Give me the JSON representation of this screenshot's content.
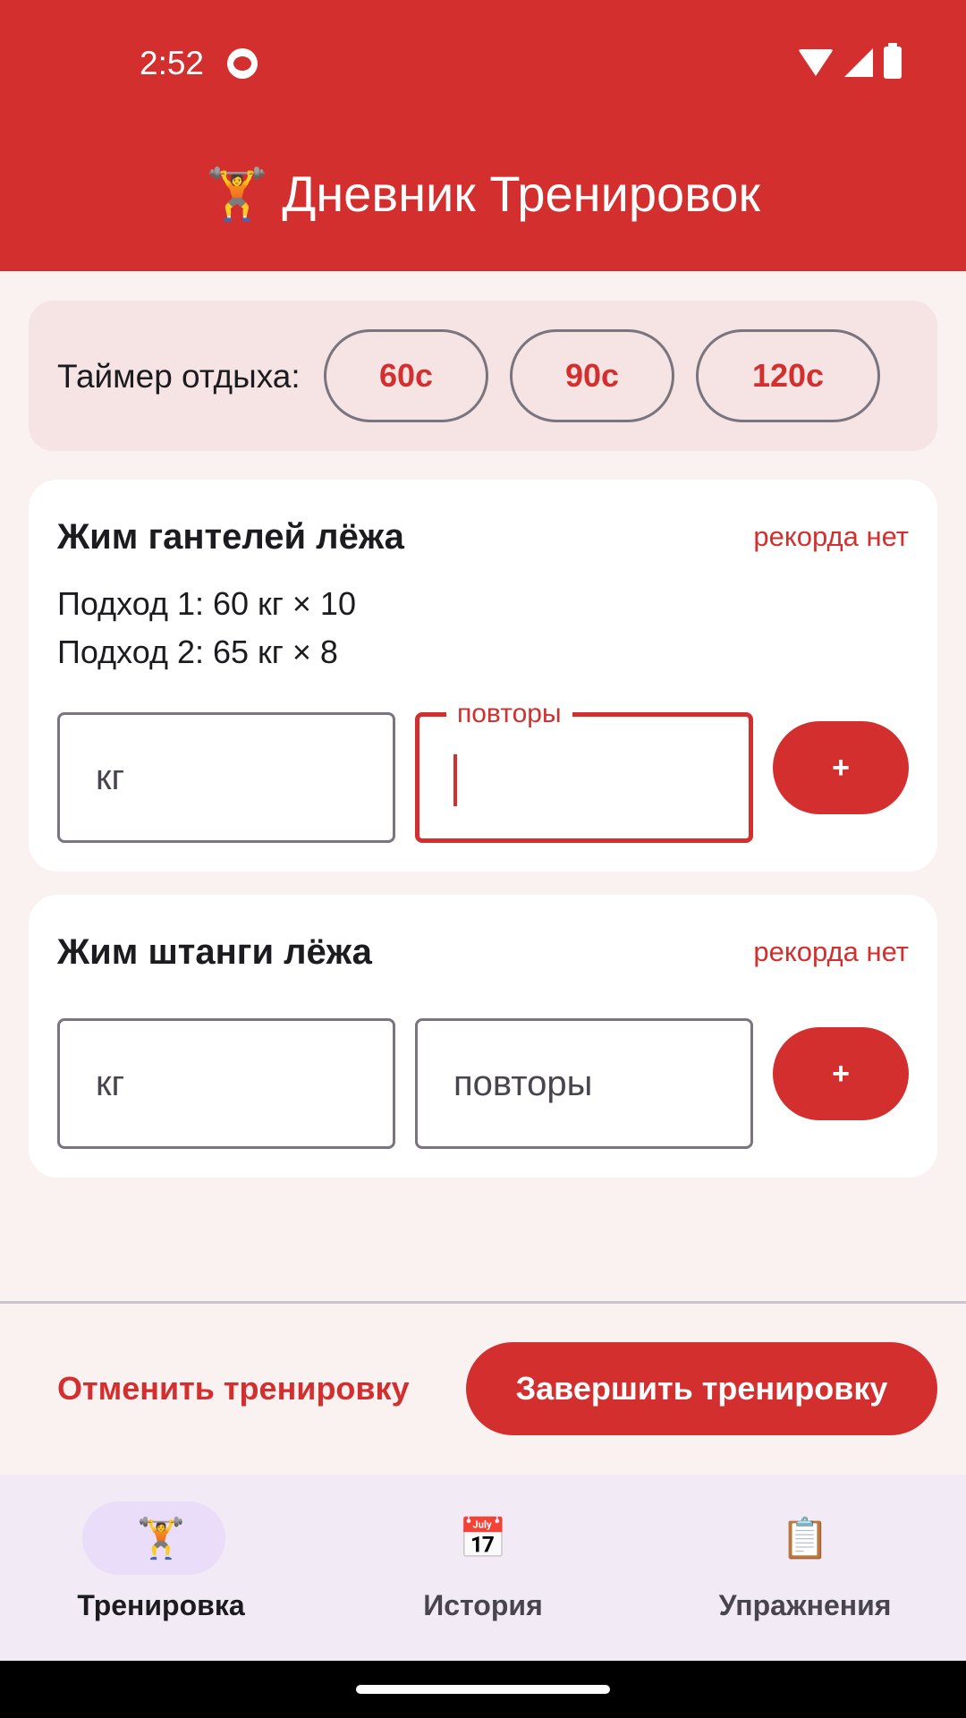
{
  "status_bar": {
    "time": "2:52"
  },
  "app_bar": {
    "title": "🏋️ Дневник Тренировок"
  },
  "rest_timer": {
    "label": "Таймер отдыха:",
    "options": [
      "60с",
      "90с",
      "120с"
    ]
  },
  "exercises": [
    {
      "name": "Жим гантелей лёжа",
      "record": "рекорда нет",
      "sets": [
        "Подход 1: 60 кг × 10",
        "Подход 2: 65 кг × 8"
      ],
      "weight_placeholder": "кг",
      "reps_placeholder": "повторы",
      "reps_label": "повторы",
      "add_label": "+"
    },
    {
      "name": "Жим штанги лёжа",
      "record": "рекорда нет",
      "sets": [],
      "weight_placeholder": "кг",
      "reps_placeholder": "повторы",
      "add_label": "+"
    }
  ],
  "actions": {
    "cancel_label": "Отменить тренировку",
    "finish_label": "Завершить тренировку"
  },
  "nav": {
    "items": [
      {
        "icon": "🏋️",
        "icon_name": "weightlifter-icon",
        "label": "Тренировка",
        "active": true
      },
      {
        "icon": "📅",
        "icon_name": "calendar-icon",
        "label": "История",
        "active": false
      },
      {
        "icon": "📋",
        "icon_name": "clipboard-icon",
        "label": "Упражнения",
        "active": false
      }
    ]
  },
  "colors": {
    "primary": "#d32f2f",
    "background": "#f9f2f1",
    "timer_panel": "#f5e4e3",
    "nav_background": "#f2ebf6",
    "nav_active_indicator": "#e9ddfa"
  }
}
